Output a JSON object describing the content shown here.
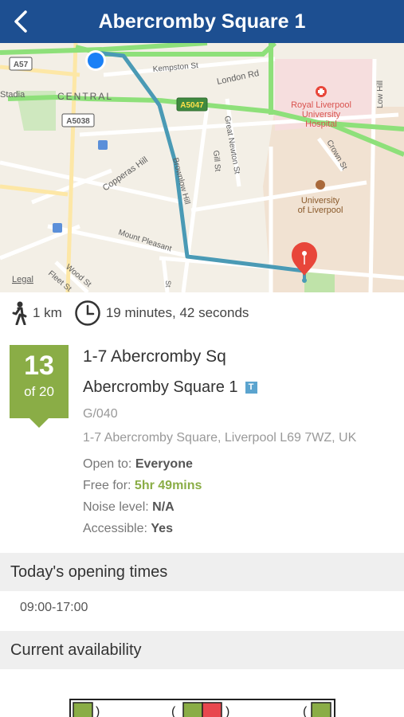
{
  "navbar": {
    "title": "Abercromby Square 1",
    "back_icon": "chevron-left-icon"
  },
  "map": {
    "labels": {
      "a57": "A57",
      "central": "CENTRAL",
      "stadia": "Stadia",
      "a5038": "A5038",
      "a5047": "A5047",
      "kempston": "Kempston St",
      "london_rd": "London Rd",
      "low_hill": "Low Hill",
      "royal1": "Royal Liverpool",
      "royal2": "University",
      "royal3": "Hospital",
      "crown": "Crown St",
      "copperas": "Copperas Hill",
      "brownlow": "Brownlow Hill",
      "great_newton": "Great Newton St",
      "gill": "Gill St",
      "uni1": "University",
      "uni2": "of Liverpool",
      "mount_pleasant": "Mount Pleasant",
      "wood": "Wood St",
      "fleet": "Fleet St",
      "legal": "Legal",
      "st": "St"
    },
    "colors": {
      "route": "#4a9ab5",
      "origin": "#1a80f6",
      "destination": "#e8463a",
      "major_road": "#8ee07a"
    }
  },
  "trip": {
    "distance": "1 km",
    "duration": "19 minutes, 42 seconds",
    "walk_icon": "walking-person-icon",
    "clock_icon": "clock-icon"
  },
  "space": {
    "rank": "13",
    "rank_of": "of 20",
    "building": "1-7 Abercromby Sq",
    "room_name": "Abercromby Square 1",
    "room_badge": "T",
    "room_code": "G/040",
    "address": "1-7 Abercromby Square, Liverpool L69 7WZ, UK",
    "open_to_label": "Open to:",
    "open_to_value": "Everyone",
    "free_for_label": "Free for:",
    "free_for_value": "5hr 49mins",
    "noise_label": "Noise level:",
    "noise_value": "N/A",
    "accessible_label": "Accessible:",
    "accessible_value": "Yes",
    "badge_color": "#8aad46"
  },
  "opening": {
    "header": "Today's opening times",
    "hours": "09:00-17:00"
  },
  "availability": {
    "header": "Current availability",
    "colors": {
      "free": "#8aad46",
      "busy": "#e8474e"
    }
  }
}
